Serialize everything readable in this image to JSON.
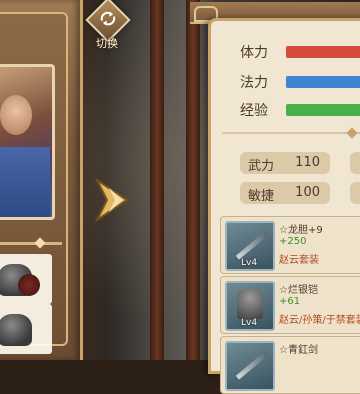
{
  "switch": {
    "label": "切换"
  },
  "stats": [
    {
      "label": "体力",
      "color": "#d64a3c"
    },
    {
      "label": "法力",
      "color": "#3f86d1"
    },
    {
      "label": "经验",
      "color": "#46b04a"
    }
  ],
  "attributes": [
    {
      "name": "武力",
      "value": "110"
    },
    {
      "name": "敏捷",
      "value": "100"
    }
  ],
  "equipment": [
    {
      "name": "☆龙胆+9",
      "bonus": "+250",
      "set": "赵云套装",
      "level": "Lv4",
      "icon": "spear-icon"
    },
    {
      "name": "☆烂银铠",
      "bonus": "+61",
      "set": "赵云/孙策/于禁套装",
      "level": "Lv4",
      "icon": "armor-icon"
    },
    {
      "name": "☆青釭剑",
      "bonus": "",
      "set": "",
      "level": "",
      "icon": "sword-icon"
    }
  ],
  "colors": {
    "panel_bg": "#f1e6d2",
    "frame_gold": "#c9a46a"
  }
}
